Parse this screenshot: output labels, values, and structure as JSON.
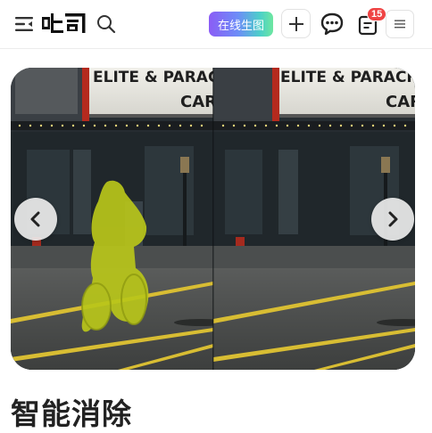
{
  "header": {
    "logo_text": "吐司",
    "online_button_label": "在线生图",
    "notification_count": "15",
    "icons": [
      "menu-fold-icon",
      "search-icon",
      "plus-icon",
      "chat-icon",
      "notes-icon",
      "hamburger-icon"
    ]
  },
  "carousel": {
    "marquee_left_line1": "ELITE & PARACHU",
    "marquee_left_line2": "CARO",
    "marquee_right_line1": "ELITE & PARACH",
    "marquee_right_line2": "CAR",
    "prev_icon": "chevron-left-icon",
    "next_icon": "chevron-right-icon",
    "mask_color": "#b9c61a"
  },
  "section": {
    "title": "智能消除"
  }
}
